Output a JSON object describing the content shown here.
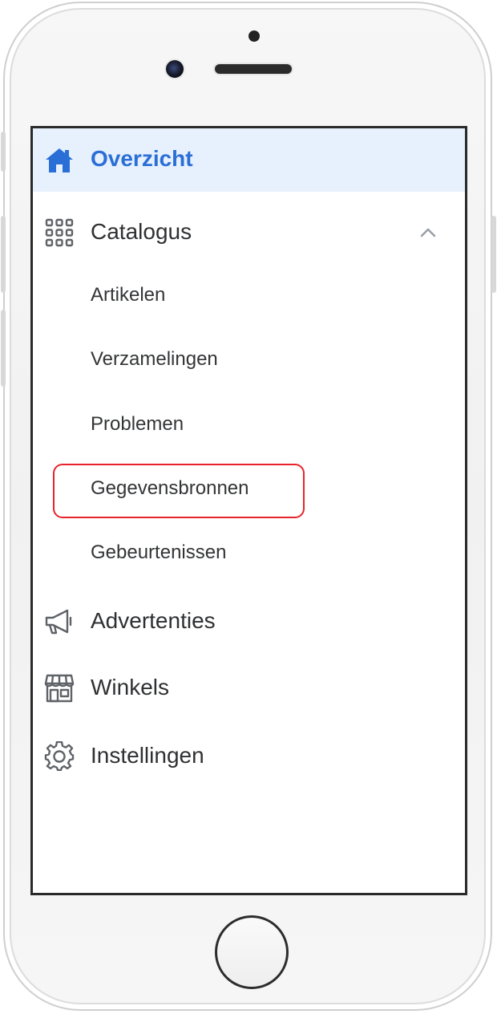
{
  "nav": {
    "items": [
      {
        "label": "Overzicht",
        "icon": "home-icon",
        "active": true
      },
      {
        "label": "Catalogus",
        "icon": "grid-icon",
        "expanded": true
      },
      {
        "label": "Advertenties",
        "icon": "megaphone-icon"
      },
      {
        "label": "Winkels",
        "icon": "store-icon"
      },
      {
        "label": "Instellingen",
        "icon": "gear-icon"
      }
    ],
    "catalog_subitems": [
      {
        "label": "Artikelen"
      },
      {
        "label": "Verzamelingen"
      },
      {
        "label": "Problemen"
      },
      {
        "label": "Gegevensbronnen",
        "highlighted": true
      },
      {
        "label": "Gebeurtenissen"
      }
    ]
  },
  "colors": {
    "accent": "#2a6fd6",
    "active_background": "#e7f0fd",
    "highlight_border": "#e8232c",
    "text": "#2f3032",
    "icon_gray": "#5f6368"
  }
}
